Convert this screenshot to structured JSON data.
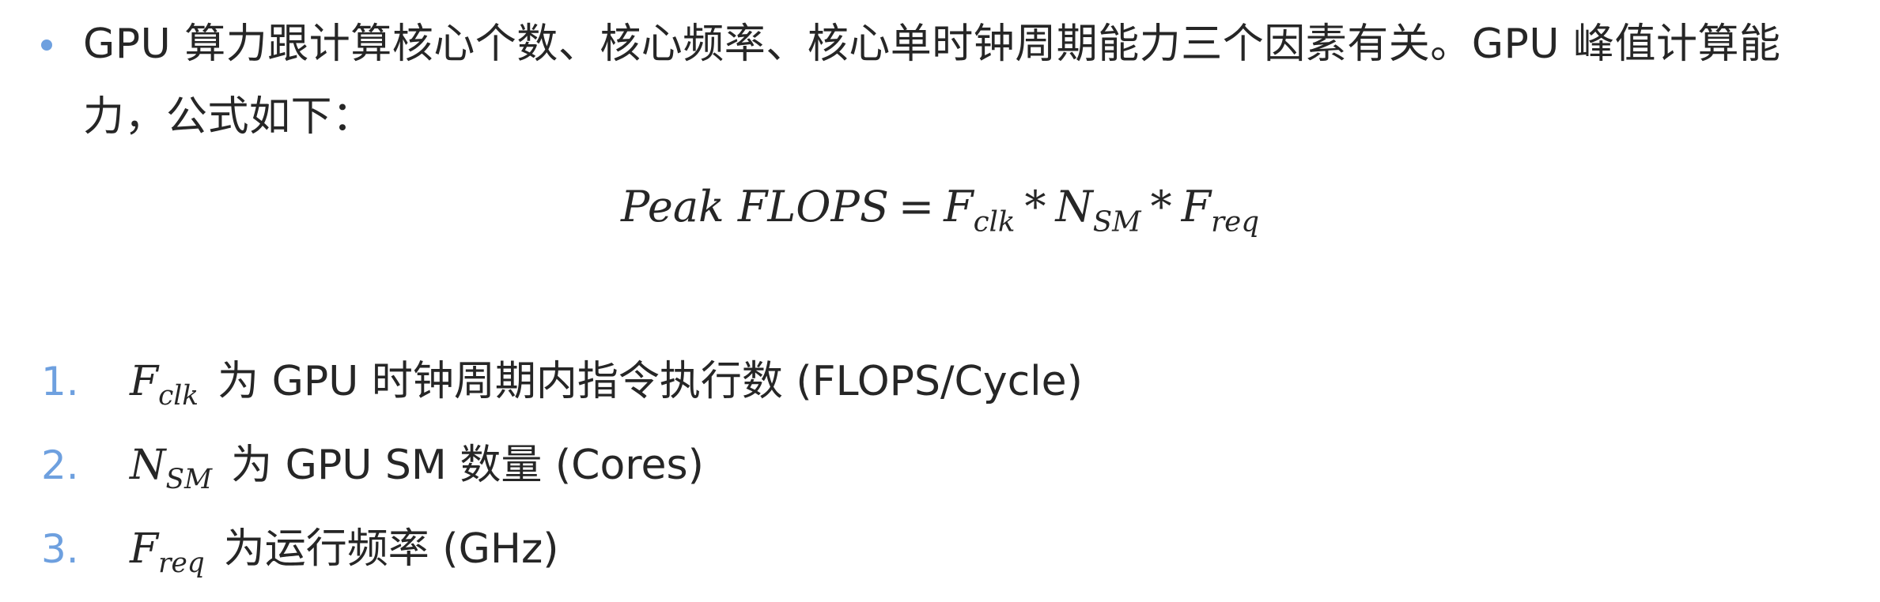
{
  "bullet": {
    "text": "GPU 算力跟计算核心个数、核心频率、核心单时钟周期能力三个因素有关。GPU 峰值计算能力，公式如下："
  },
  "formula": {
    "lhs": "Peak FLOPS",
    "equals": "=",
    "term1_base": "F",
    "term1_sub": "clk",
    "times": "*",
    "term2_base": "N",
    "term2_sub": "SM",
    "term3_base": "F",
    "term3_sub": "req"
  },
  "list": [
    {
      "number": "1.",
      "var_base": "F",
      "var_sub": "clk",
      "text": "为 GPU 时钟周期内指令执行数 (FLOPS/Cycle)"
    },
    {
      "number": "2.",
      "var_base": "N",
      "var_sub": "SM",
      "text": "为 GPU SM 数量 (Cores)"
    },
    {
      "number": "3.",
      "var_base": "F",
      "var_sub": "req",
      "text": "为运行频率 (GHz)"
    }
  ],
  "colors": {
    "accent": "#6ea0df",
    "text": "#262626"
  }
}
